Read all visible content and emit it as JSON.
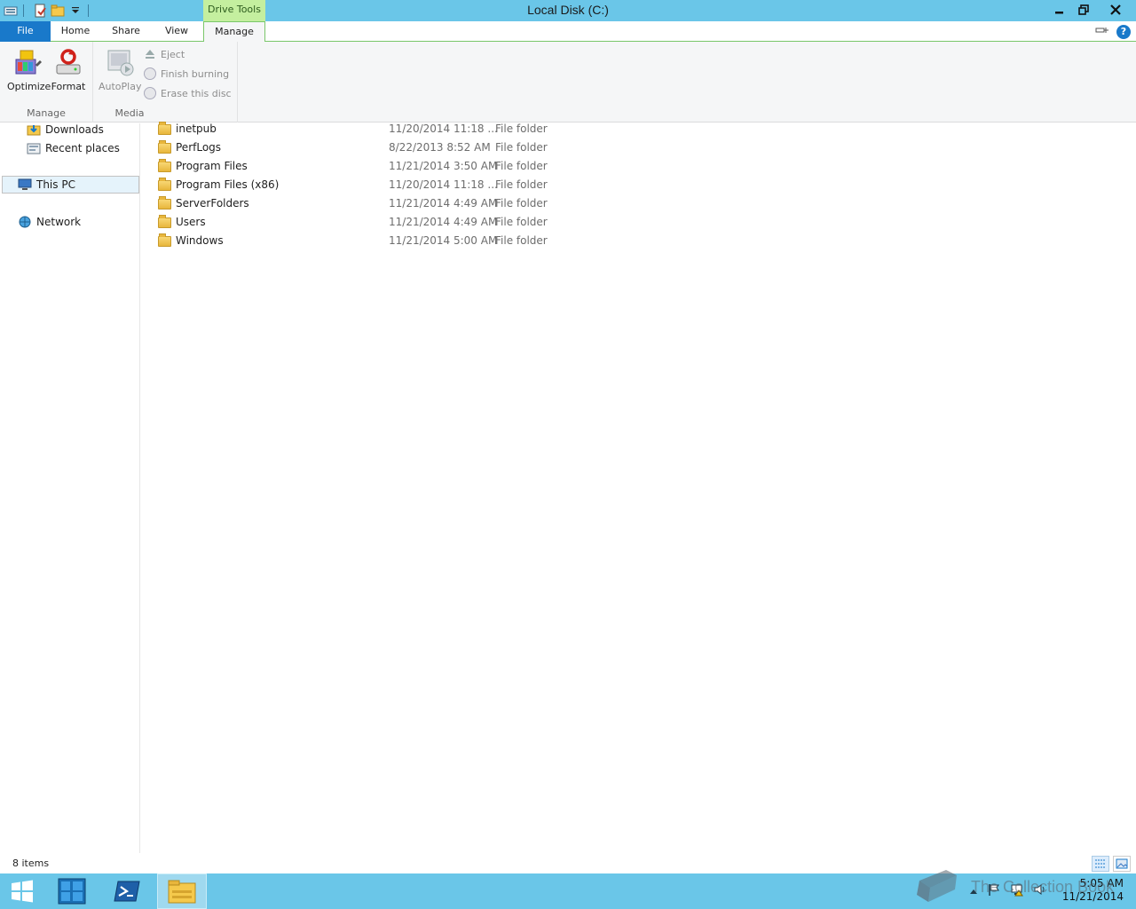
{
  "window": {
    "title": "Local Disk (C:)",
    "context_tab_group": "Drive Tools"
  },
  "ribbon_tabs": {
    "file": "File",
    "home": "Home",
    "share": "Share",
    "view": "View",
    "manage": "Manage"
  },
  "ribbon": {
    "manage_group": {
      "label": "Manage",
      "optimize": "Optimize",
      "format": "Format"
    },
    "media_group": {
      "label": "Media",
      "autoplay": "AutoPlay",
      "eject": "Eject",
      "finish_burning": "Finish burning",
      "erase_disc": "Erase this disc"
    }
  },
  "nav_pane": {
    "downloads": "Downloads",
    "recent_places": "Recent places",
    "this_pc": "This PC",
    "network": "Network"
  },
  "files": [
    {
      "name": "inetpub",
      "date": "11/20/2014 11:18 ...",
      "type": "File folder"
    },
    {
      "name": "PerfLogs",
      "date": "8/22/2013 8:52 AM",
      "type": "File folder"
    },
    {
      "name": "Program Files",
      "date": "11/21/2014 3:50 AM",
      "type": "File folder"
    },
    {
      "name": "Program Files (x86)",
      "date": "11/20/2014 11:18 ...",
      "type": "File folder"
    },
    {
      "name": "ServerFolders",
      "date": "11/21/2014 4:49 AM",
      "type": "File folder"
    },
    {
      "name": "Users",
      "date": "11/21/2014 4:49 AM",
      "type": "File folder"
    },
    {
      "name": "Windows",
      "date": "11/21/2014 5:00 AM",
      "type": "File folder"
    }
  ],
  "status": {
    "item_count": "8 items"
  },
  "taskbar": {
    "clock_time": "5:05 AM",
    "clock_date": "11/21/2014"
  },
  "watermark": {
    "text": "The Collection Book"
  },
  "colors": {
    "titlebar": "#6ac6e8",
    "file_tab": "#1979ca",
    "context_tab": "#c4ef9f"
  }
}
